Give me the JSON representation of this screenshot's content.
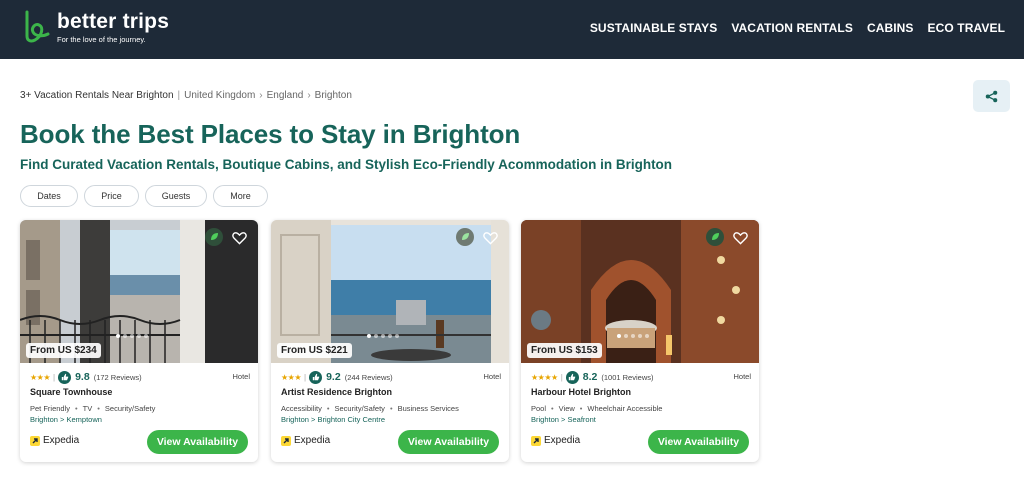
{
  "header": {
    "brand_name": "better trips",
    "tagline": "For the love of the journey.",
    "nav": [
      {
        "label": "SUSTAINABLE STAYS"
      },
      {
        "label": "VACATION RENTALS"
      },
      {
        "label": "CABINS"
      },
      {
        "label": "ECO TRAVEL"
      }
    ],
    "background_color": "#1e2a38",
    "logo_color": "#3cb54a"
  },
  "breadcrumb": {
    "current": "3+ Vacation Rentals Near Brighton",
    "separator": "|",
    "trail": [
      "United Kingdom",
      "England",
      "Brighton"
    ]
  },
  "share_icon": "share-icon",
  "page": {
    "title": "Book the Best Places to Stay in Brighton",
    "subtitle": "Find Curated Vacation Rentals, Boutique Cabins, and Stylish Eco-Friendly Acommodation in Brighton",
    "accent_color": "#17645a"
  },
  "filters": [
    {
      "label": "Dates"
    },
    {
      "label": "Price"
    },
    {
      "label": "Guests"
    },
    {
      "label": "More"
    }
  ],
  "cards": [
    {
      "name": "Square Townhouse",
      "price": "From US $234",
      "stars": "★★★",
      "score": "9.8",
      "reviews": "(172 Reviews)",
      "type": "Hotel",
      "amenities": [
        "Pet Friendly",
        "TV",
        "Security/Safety"
      ],
      "location": "Brighton > Kemptown",
      "provider": "Expedia",
      "cta": "View Availability"
    },
    {
      "name": "Artist Residence Brighton",
      "price": "From US $221",
      "stars": "★★★",
      "score": "9.2",
      "reviews": "(244 Reviews)",
      "type": "Hotel",
      "amenities": [
        "Accessibility",
        "Security/Safety",
        "Business Services"
      ],
      "location": "Brighton > Brighton City Centre",
      "provider": "Expedia",
      "cta": "View Availability"
    },
    {
      "name": "Harbour Hotel Brighton",
      "price": "From US $153",
      "stars": "★★★★",
      "score": "8.2",
      "reviews": "(1001 Reviews)",
      "type": "Hotel",
      "amenities": [
        "Pool",
        "View",
        "Wheelchair Accessible"
      ],
      "location": "Brighton > Seafront",
      "provider": "Expedia",
      "cta": "View Availability"
    }
  ],
  "cta_color": "#3cb54a"
}
